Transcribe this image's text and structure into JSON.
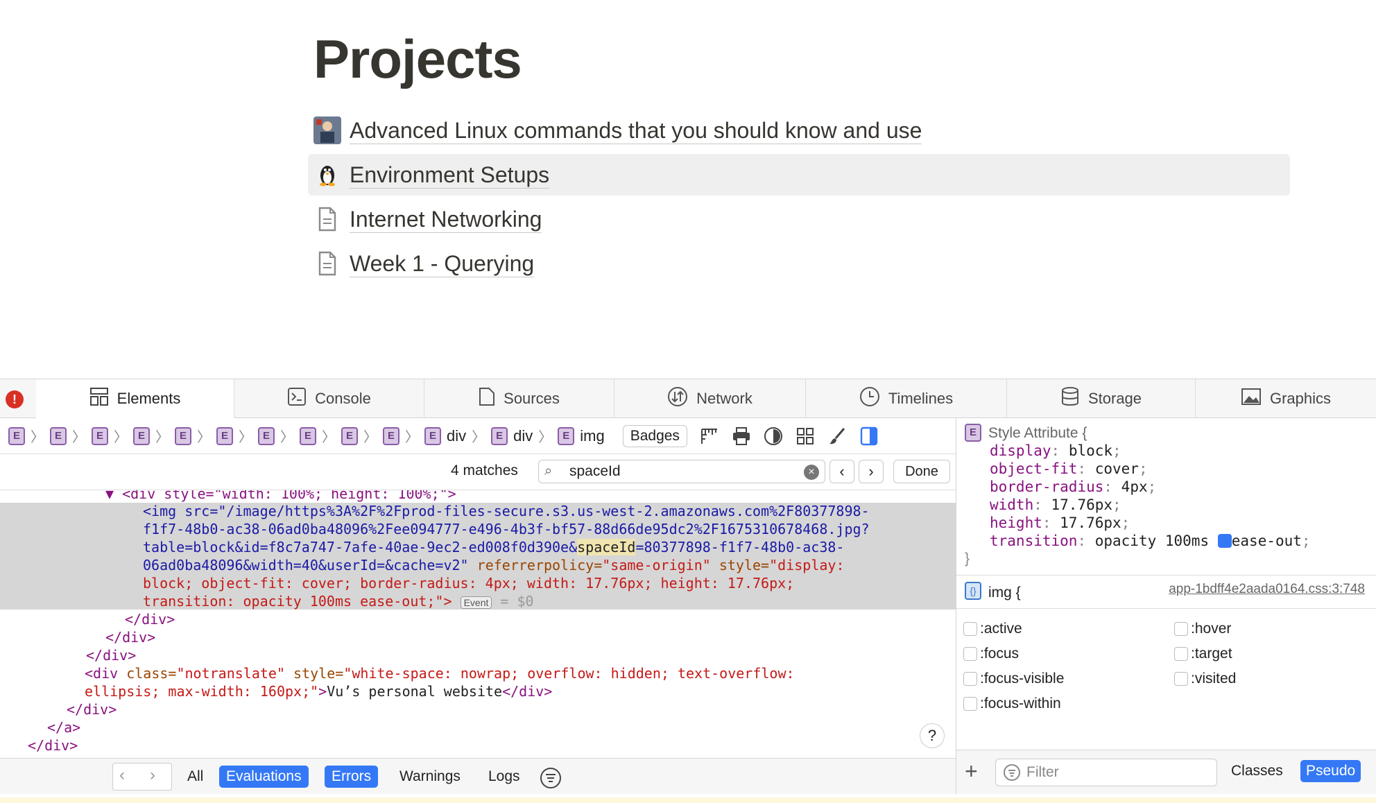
{
  "page": {
    "title": "Projects",
    "items": [
      {
        "label": "Advanced Linux commands that you should know and use",
        "icon": "avatar-icon"
      },
      {
        "label": "Environment Setups",
        "icon": "penguin-icon"
      },
      {
        "label": "Internet Networking",
        "icon": "document-icon"
      },
      {
        "label": "Week 1 - Querying",
        "icon": "document-icon"
      }
    ]
  },
  "devtools": {
    "tabs": [
      "Elements",
      "Console",
      "Sources",
      "Network",
      "Timelines",
      "Storage",
      "Graphics"
    ],
    "error_glyph": "!",
    "breadcrumb": {
      "badge_letter": "E",
      "crumbs": [
        "div",
        "div",
        "img"
      ],
      "badges_label": "Badges"
    },
    "search": {
      "matches": "4 matches",
      "query": "spaceId",
      "done": "Done",
      "prev": "‹",
      "next": "›",
      "clear": "×"
    },
    "code_lines": {
      "l0": "▼ <div style=\"width: 100%; height: 100%;\">",
      "l1a": "<img src=\"/image/https%3A%2F%2Fprod-files-secure.s3.us-west-2.amazonaws.com%2F80377898-",
      "l2": "f1f7-48b0-ac38-06ad0ba48096%2Fee094777-e496-4b3f-bf57-88d66de95dc2%2F1675310678468.jpg?",
      "l3a": "table=block&id=f8c7a747-7afe-40ae-9ec2-ed008f0d390e&",
      "l3b": "spaceId",
      "l3c": "=80377898-f1f7-48b0-ac38-",
      "l4a": "06ad0ba48096&width=40&userId=&cache=v2\"",
      "l4b": " referrerpolicy=",
      "l4c": "\"same-origin\"",
      "l4d": " style=",
      "l4e": "\"display:",
      "l5": "block; object-fit: cover; border-radius: 4px; width: 17.76px; height: 17.76px;",
      "l6a": "transition: opacity 100ms ease-out;\">",
      "l6b": "Event",
      "l6c": " = $0",
      "l7": "</div>",
      "l8": "</div>",
      "l9": "</div>",
      "l10a": "<div ",
      "l10b": "class=",
      "l10c": "\"notranslate\"",
      "l10d": " style=",
      "l10e": "\"white-space: nowrap; overflow: hidden; text-overflow:",
      "l11a": "ellipsis; max-width: 160px;\"",
      "l11b": ">",
      "l11c": "Vu’s personal website",
      "l11d": "</div>",
      "l12": "</div>",
      "l13": "</a>",
      "l14": "</div>"
    },
    "help": "?",
    "console": {
      "filters": [
        "All",
        "Evaluations",
        "Errors",
        "Warnings",
        "Logs"
      ]
    },
    "styles": {
      "style_attr_header": "Style Attribute {",
      "props": [
        {
          "name": "display",
          "value": "block"
        },
        {
          "name": "object-fit",
          "value": "cover"
        },
        {
          "name": "border-radius",
          "value": "4px"
        },
        {
          "name": "width",
          "value": "17.76px"
        },
        {
          "name": "height",
          "value": "17.76px"
        },
        {
          "name": "transition",
          "value": "opacity 100ms",
          "value2": "ease-out"
        }
      ],
      "close_brace": "}",
      "rule_selector": "img {",
      "rule_source": "app-1bdff4e2aada0164.css:3:748",
      "pseudo_left": [
        ":active",
        ":focus",
        ":focus-visible",
        ":focus-within"
      ],
      "pseudo_right": [
        ":hover",
        ":target",
        ":visited"
      ],
      "filter_placeholder": "Filter",
      "classes_label": "Classes",
      "pseudo_label": "Pseudo"
    }
  }
}
